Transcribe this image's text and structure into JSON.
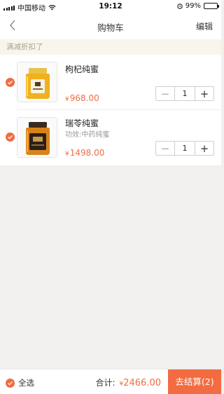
{
  "status_bar": {
    "carrier": "中国移动",
    "time": "19:12",
    "battery": "99%"
  },
  "nav": {
    "title": "购物车",
    "edit_label": "编辑"
  },
  "promo": {
    "text": "满减折扣了"
  },
  "cart": {
    "items": [
      {
        "name": "枸杞纯蜜",
        "subtitle": "",
        "currency": "¥",
        "price": "968.00",
        "quantity": "1",
        "selected": true
      },
      {
        "name": "瑞苓纯蜜",
        "subtitle": "功效:中药纯蜜",
        "currency": "¥",
        "price": "1498.00",
        "quantity": "1",
        "selected": true
      }
    ]
  },
  "stepper": {
    "minus": "−",
    "plus": "+"
  },
  "footer": {
    "select_all_label": "全选",
    "total_label": "合计:",
    "currency": "¥",
    "total_amount": "2466.00",
    "checkout_label": "去结算(2)"
  },
  "colors": {
    "accent": "#f26b41",
    "promo_bg": "#f8f6ec",
    "page_bg": "#f1f0ee"
  }
}
